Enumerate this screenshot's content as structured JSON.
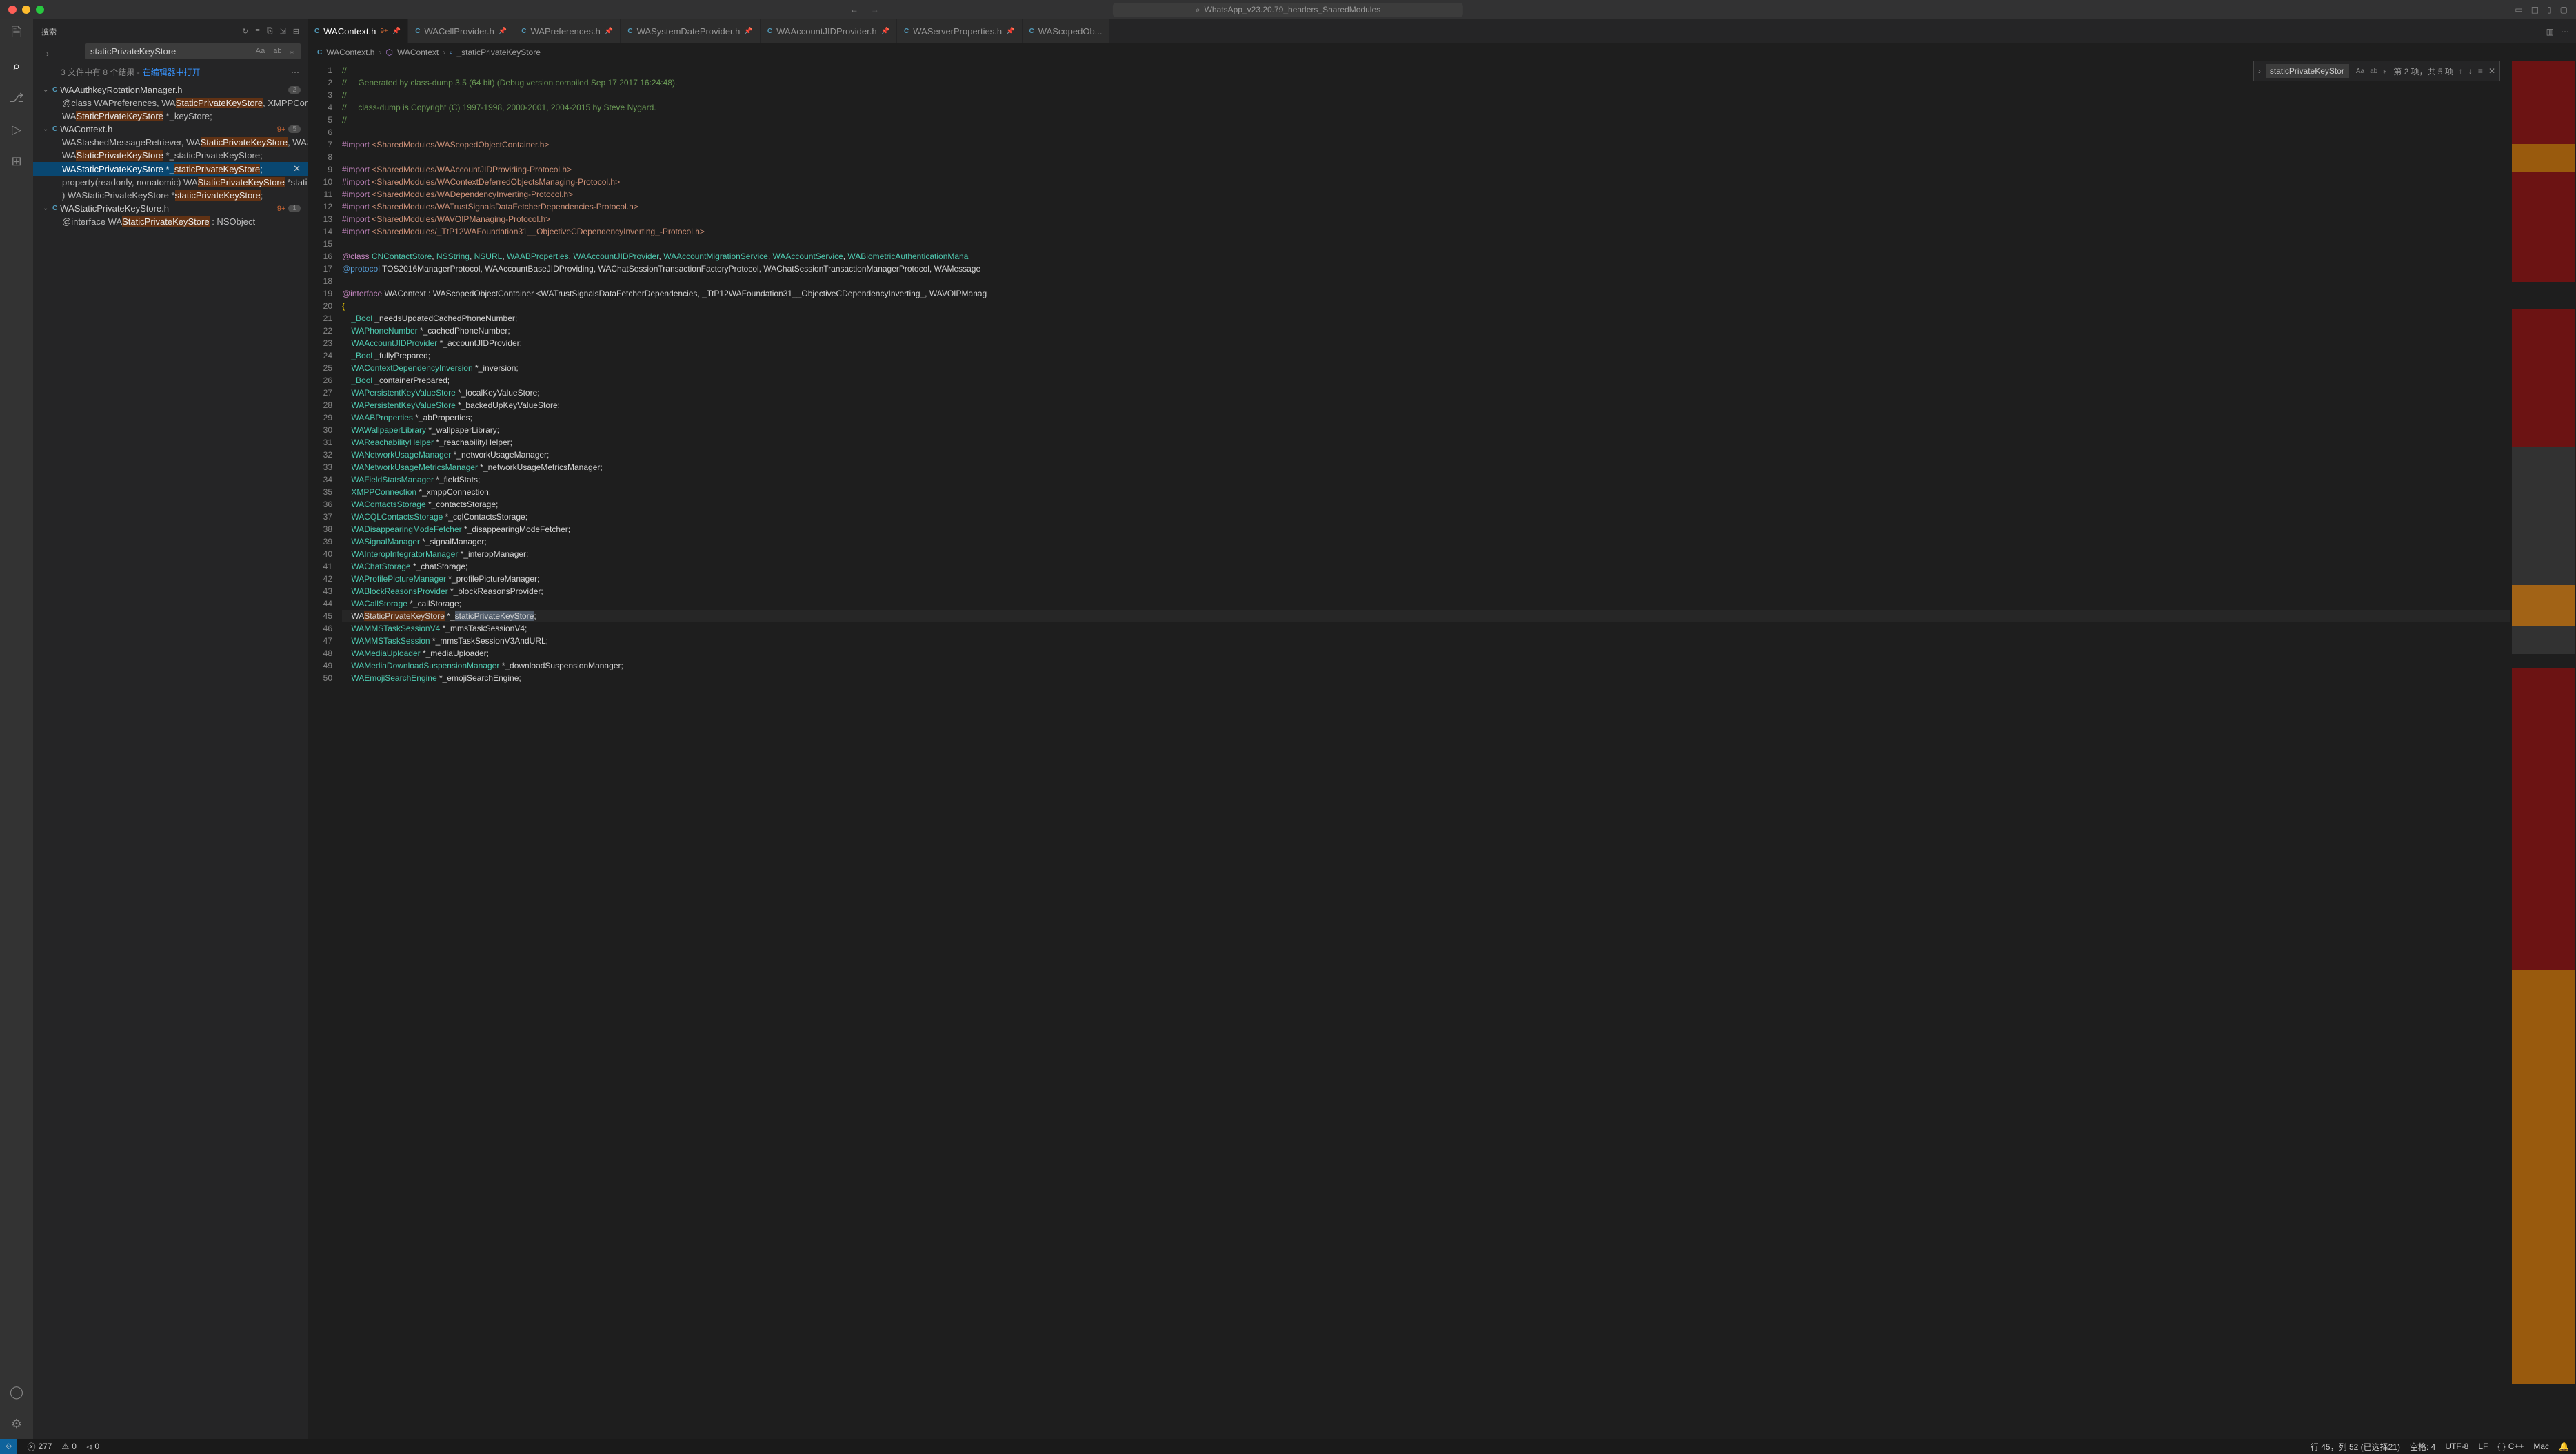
{
  "titlebar": {
    "address": "WhatsApp_v23.20.79_headers_SharedModules"
  },
  "sidebar": {
    "title": "搜索",
    "search_value": "staticPrivateKeyStore",
    "summary_prefix": "3 文件中有 8 个结果 - ",
    "summary_link": "在编辑器中打开",
    "files": [
      {
        "icon": "C",
        "name": "WAAuthkeyRotationManager.h",
        "badge_text": "",
        "badge_count": "2",
        "matches": [
          {
            "pre": "@class WAPreferences, WA",
            "hl": "StaticPrivateKeyStore",
            "post": ", XMPPConnection;"
          },
          {
            "pre": "WA",
            "hl": "StaticPrivateKeyStore",
            "post": " *_keyStore;"
          }
        ]
      },
      {
        "icon": "C",
        "name": "WAContext.h",
        "badge_text": "9+",
        "badge_count": "5",
        "matches": [
          {
            "pre": "WAStashedMessageRetriever, WA",
            "hl": "StaticPrivateKeyStore",
            "post": ", WAStatusPrivacyPoli..."
          },
          {
            "pre": "WA",
            "hl": "StaticPrivateKeyStore",
            "post": " *_staticPrivateKeyStore;"
          },
          {
            "pre": "WAStaticPrivateKeyStore *_",
            "hl": "staticPrivateKeyStore",
            "post": ";",
            "selected": true
          },
          {
            "pre": "property(readonly, nonatomic) WA",
            "hl": "StaticPrivateKeyStore",
            "post": " *staticPrivateKeyStore;"
          },
          {
            "pre": ") WAStaticPrivateKeyStore *",
            "hl": "staticPrivateKeyStore",
            "post": ";"
          }
        ]
      },
      {
        "icon": "C",
        "name": "WAStaticPrivateKeyStore.h",
        "badge_text": "9+",
        "badge_count": "1",
        "matches": [
          {
            "pre": "@interface WA",
            "hl": "StaticPrivateKeyStore",
            "post": " : NSObject"
          }
        ]
      }
    ]
  },
  "tabs": [
    {
      "icon": "C",
      "name": "WAContext.h",
      "mod": "9+",
      "pin": true,
      "active": true
    },
    {
      "icon": "C",
      "name": "WACellProvider.h",
      "pin": true
    },
    {
      "icon": "C",
      "name": "WAPreferences.h",
      "pin": true
    },
    {
      "icon": "C",
      "name": "WASystemDateProvider.h",
      "pin": true
    },
    {
      "icon": "C",
      "name": "WAAccountJIDProvider.h",
      "pin": true
    },
    {
      "icon": "C",
      "name": "WAServerProperties.h",
      "pin": true
    },
    {
      "icon": "C",
      "name": "WAScopedOb..."
    }
  ],
  "breadcrumb": {
    "c1": "WAContext.h",
    "c2": "WAContext",
    "c3": "_staticPrivateKeyStore"
  },
  "find": {
    "value": "staticPrivateKeyStor",
    "info": "第 2 项，共 5 项"
  },
  "code_lines": [
    {
      "n": 1,
      "t": "comment",
      "s": "//"
    },
    {
      "n": 2,
      "t": "comment",
      "s": "//     Generated by class-dump 3.5 (64 bit) (Debug version compiled Sep 17 2017 16:24:48)."
    },
    {
      "n": 3,
      "t": "comment",
      "s": "//"
    },
    {
      "n": 4,
      "t": "comment",
      "s": "//     class-dump is Copyright (C) 1997-1998, 2000-2001, 2004-2015 by Steve Nygard."
    },
    {
      "n": 5,
      "t": "comment",
      "s": "//"
    },
    {
      "n": 6,
      "t": "",
      "s": ""
    },
    {
      "n": 7,
      "t": "import",
      "s": "#import <SharedModules/WAScopedObjectContainer.h>"
    },
    {
      "n": 8,
      "t": "",
      "s": ""
    },
    {
      "n": 9,
      "t": "import",
      "s": "#import <SharedModules/WAAccountJIDProviding-Protocol.h>"
    },
    {
      "n": 10,
      "t": "import",
      "s": "#import <SharedModules/WAContextDeferredObjectsManaging-Protocol.h>"
    },
    {
      "n": 11,
      "t": "import",
      "s": "#import <SharedModules/WADependencyInverting-Protocol.h>"
    },
    {
      "n": 12,
      "t": "import",
      "s": "#import <SharedModules/WATrustSignalsDataFetcherDependencies-Protocol.h>"
    },
    {
      "n": 13,
      "t": "import",
      "s": "#import <SharedModules/WAVOIPManaging-Protocol.h>"
    },
    {
      "n": 14,
      "t": "import",
      "s": "#import <SharedModules/_TtP12WAFoundation31__ObjectiveCDependencyInverting_-Protocol.h>"
    },
    {
      "n": 15,
      "t": "",
      "s": ""
    },
    {
      "n": 16,
      "t": "class",
      "s": "@class CNContactStore, NSString, NSURL, WAABProperties, WAAccountJIDProvider, WAAccountMigrationService, WAAccountService, WABiometricAuthenticationMana"
    },
    {
      "n": 17,
      "t": "proto",
      "s": "@protocol TOS2016ManagerProtocol, WAAccountBaseJIDProviding, WAChatSessionTransactionFactoryProtocol, WAChatSessionTransactionManagerProtocol, WAMessage"
    },
    {
      "n": 18,
      "t": "",
      "s": ""
    },
    {
      "n": 19,
      "t": "iface",
      "s": "@interface WAContext : WAScopedObjectContainer <WATrustSignalsDataFetcherDependencies, _TtP12WAFoundation31__ObjectiveCDependencyInverting_, WAVOIPManag"
    },
    {
      "n": 20,
      "t": "brace",
      "s": "{"
    },
    {
      "n": 21,
      "t": "decl",
      "s": "    _Bool _needsUpdatedCachedPhoneNumber;"
    },
    {
      "n": 22,
      "t": "decl",
      "s": "    WAPhoneNumber *_cachedPhoneNumber;"
    },
    {
      "n": 23,
      "t": "decl",
      "s": "    WAAccountJIDProvider *_accountJIDProvider;"
    },
    {
      "n": 24,
      "t": "decl",
      "s": "    _Bool _fullyPrepared;"
    },
    {
      "n": 25,
      "t": "decl",
      "s": "    WAContextDependencyInversion *_inversion;"
    },
    {
      "n": 26,
      "t": "decl",
      "s": "    _Bool _containerPrepared;"
    },
    {
      "n": 27,
      "t": "decl",
      "s": "    WAPersistentKeyValueStore *_localKeyValueStore;"
    },
    {
      "n": 28,
      "t": "decl",
      "s": "    WAPersistentKeyValueStore *_backedUpKeyValueStore;"
    },
    {
      "n": 29,
      "t": "decl",
      "s": "    WAABProperties *_abProperties;"
    },
    {
      "n": 30,
      "t": "decl",
      "s": "    WAWallpaperLibrary *_wallpaperLibrary;"
    },
    {
      "n": 31,
      "t": "decl",
      "s": "    WAReachabilityHelper *_reachabilityHelper;"
    },
    {
      "n": 32,
      "t": "decl",
      "s": "    WANetworkUsageManager *_networkUsageManager;"
    },
    {
      "n": 33,
      "t": "decl",
      "s": "    WANetworkUsageMetricsManager *_networkUsageMetricsManager;"
    },
    {
      "n": 34,
      "t": "decl",
      "s": "    WAFieldStatsManager *_fieldStats;"
    },
    {
      "n": 35,
      "t": "decl",
      "s": "    XMPPConnection *_xmppConnection;"
    },
    {
      "n": 36,
      "t": "decl",
      "s": "    WAContactsStorage *_contactsStorage;"
    },
    {
      "n": 37,
      "t": "decl",
      "s": "    WACQLContactsStorage *_cqlContactsStorage;"
    },
    {
      "n": 38,
      "t": "decl",
      "s": "    WADisappearingModeFetcher *_disappearingModeFetcher;"
    },
    {
      "n": 39,
      "t": "decl",
      "s": "    WASignalManager *_signalManager;"
    },
    {
      "n": 40,
      "t": "decl",
      "s": "    WAInteropIntegratorManager *_interopManager;"
    },
    {
      "n": 41,
      "t": "decl",
      "s": "    WAChatStorage *_chatStorage;"
    },
    {
      "n": 42,
      "t": "decl",
      "s": "    WAProfilePictureManager *_profilePictureManager;"
    },
    {
      "n": 43,
      "t": "decl",
      "s": "    WABlockReasonsProvider *_blockReasonsProvider;"
    },
    {
      "n": 44,
      "t": "decl",
      "s": "    WACallStorage *_callStorage;"
    },
    {
      "n": 45,
      "t": "hlmatch",
      "s": "    WAStaticPrivateKeyStore *_staticPrivateKeyStore;",
      "bulb": true
    },
    {
      "n": 46,
      "t": "decl",
      "s": "    WAMMSTaskSessionV4 *_mmsTaskSessionV4;"
    },
    {
      "n": 47,
      "t": "decl",
      "s": "    WAMMSTaskSession *_mmsTaskSessionV3AndURL;"
    },
    {
      "n": 48,
      "t": "decl",
      "s": "    WAMediaUploader *_mediaUploader;"
    },
    {
      "n": 49,
      "t": "decl",
      "s": "    WAMediaDownloadSuspensionManager *_downloadSuspensionManager;"
    },
    {
      "n": 50,
      "t": "decl",
      "s": "    WAEmojiSearchEngine *_emojiSearchEngine;"
    }
  ],
  "statusbar": {
    "errors": "277",
    "warnings": "0",
    "ports": "0",
    "line_col": "行 45，列 52 (已选择21)",
    "spaces": "空格: 4",
    "encoding": "UTF-8",
    "eol": "LF",
    "lang": "C++",
    "host": "Mac"
  }
}
